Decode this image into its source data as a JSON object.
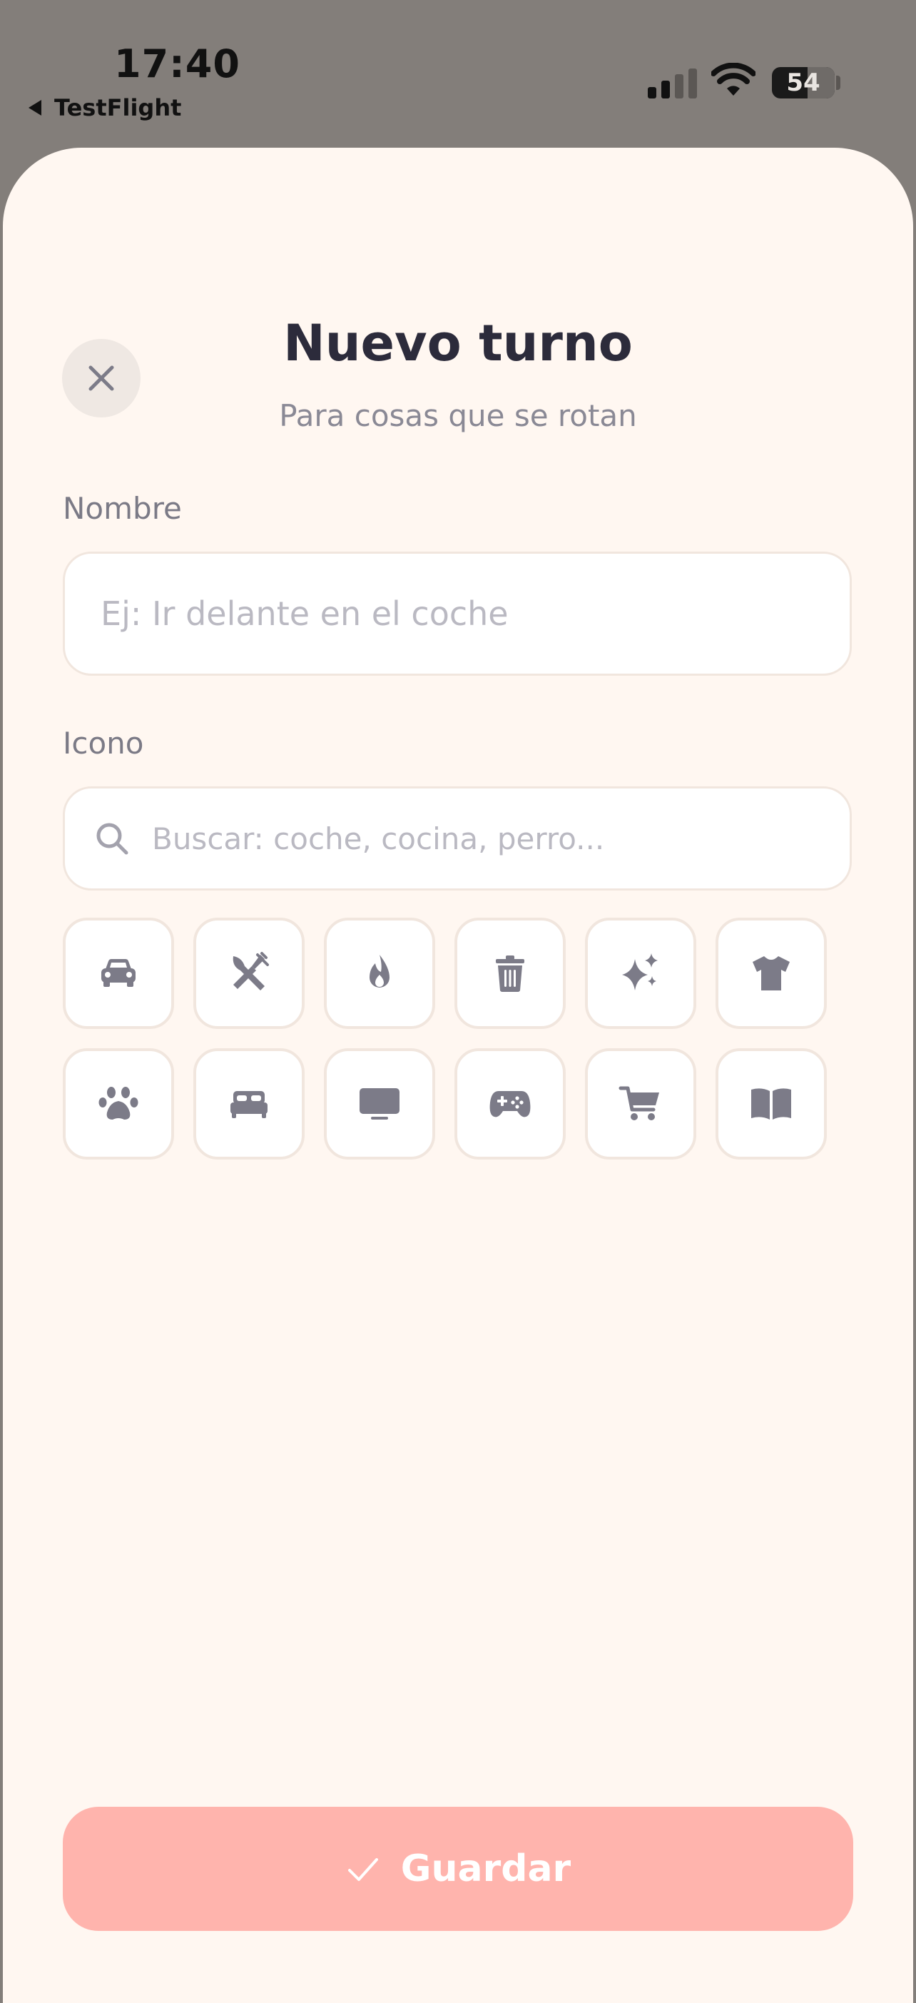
{
  "status_bar": {
    "time": "17:40",
    "back_label": "TestFlight",
    "battery": "54"
  },
  "header": {
    "title": "Nuevo turno",
    "subtitle": "Para cosas que se rotan"
  },
  "form": {
    "name_label": "Nombre",
    "name_placeholder": "Ej: Ir delante en el coche",
    "name_value": "",
    "icon_label": "Icono",
    "search_placeholder": "Buscar: coche, cocina, perro...",
    "search_value": ""
  },
  "icons": [
    "car-icon",
    "utensils-icon",
    "flame-icon",
    "trash-icon",
    "sparkles-icon",
    "shirt-icon",
    "paw-icon",
    "bed-icon",
    "tv-icon",
    "gamepad-icon",
    "cart-icon",
    "book-icon"
  ],
  "save_button": {
    "label": "Guardar"
  },
  "colors": {
    "accent": "#ffb4ad",
    "background": "#fff7f1",
    "icon": "#7c7b88",
    "title": "#2c2b3b"
  }
}
